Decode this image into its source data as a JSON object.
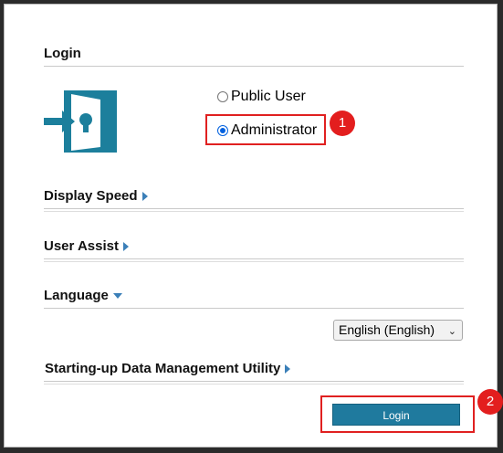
{
  "login_section": {
    "title": "Login",
    "options": [
      {
        "label": "Public User",
        "checked": false
      },
      {
        "label": "Administrator",
        "checked": true
      }
    ]
  },
  "sections": {
    "display_speed": "Display Speed",
    "user_assist": "User Assist",
    "language": "Language",
    "startup_utility": "Starting-up Data Management Utility"
  },
  "language_select": {
    "value": "English (English)"
  },
  "login_button": "Login",
  "annotations": {
    "step1": "1",
    "step2": "2"
  },
  "colors": {
    "accent": "#1f7a9e",
    "highlight": "#e02020",
    "arrow": "#3b7fb8"
  }
}
